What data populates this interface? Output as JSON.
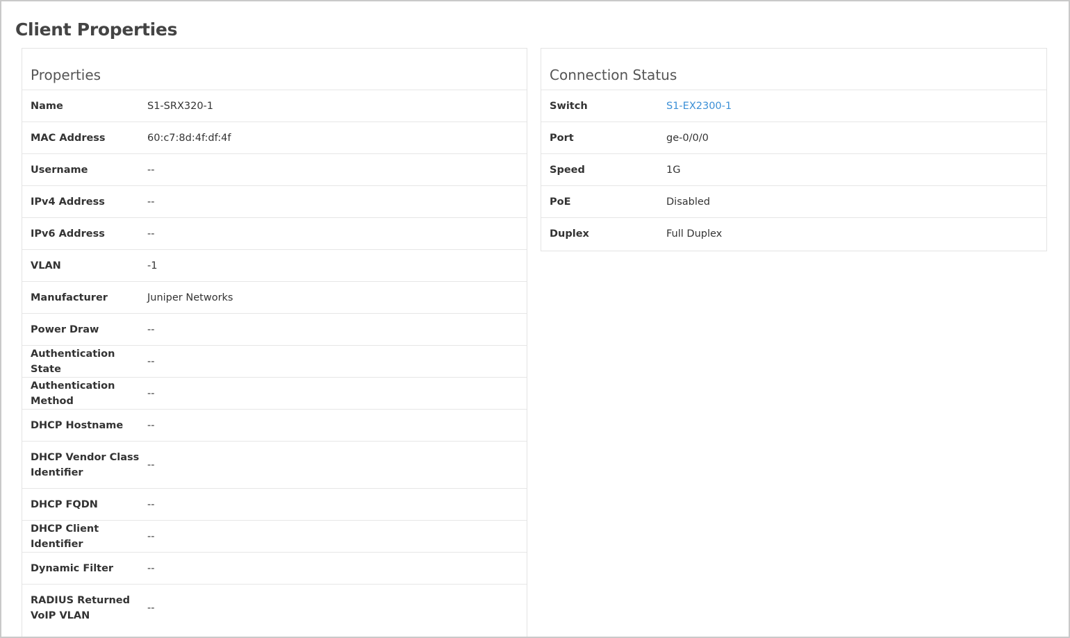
{
  "page": {
    "title": "Client Properties"
  },
  "properties": {
    "header": "Properties",
    "rows": [
      {
        "label": "Name",
        "value": "S1-SRX320-1"
      },
      {
        "label": "MAC Address",
        "value": "60:c7:8d:4f:df:4f"
      },
      {
        "label": "Username",
        "value": "--"
      },
      {
        "label": "IPv4 Address",
        "value": "--"
      },
      {
        "label": "IPv6 Address",
        "value": "--"
      },
      {
        "label": "VLAN",
        "value": "-1"
      },
      {
        "label": "Manufacturer",
        "value": "Juniper Networks"
      },
      {
        "label": "Power Draw",
        "value": "--"
      },
      {
        "label": "Authentication State",
        "value": "--"
      },
      {
        "label": "Authentication Method",
        "value": "--"
      },
      {
        "label": "DHCP Hostname",
        "value": "--"
      },
      {
        "label": "DHCP Vendor Class Identifier",
        "value": "--"
      },
      {
        "label": "DHCP FQDN",
        "value": "--"
      },
      {
        "label": "DHCP Client Identifier",
        "value": "--"
      },
      {
        "label": "Dynamic Filter",
        "value": "--"
      },
      {
        "label": "RADIUS Returned VoIP VLAN",
        "value": "--"
      }
    ]
  },
  "connection": {
    "header": "Connection Status",
    "rows": [
      {
        "label": "Switch",
        "value": "S1-EX2300-1"
      },
      {
        "label": "Port",
        "value": "ge-0/0/0"
      },
      {
        "label": "Speed",
        "value": "1G"
      },
      {
        "label": "PoE",
        "value": "Disabled"
      },
      {
        "label": "Duplex",
        "value": "Full Duplex"
      }
    ]
  },
  "colors": {
    "link": "#3b8fd6",
    "border": "#e6e6e6",
    "title": "#444444"
  }
}
